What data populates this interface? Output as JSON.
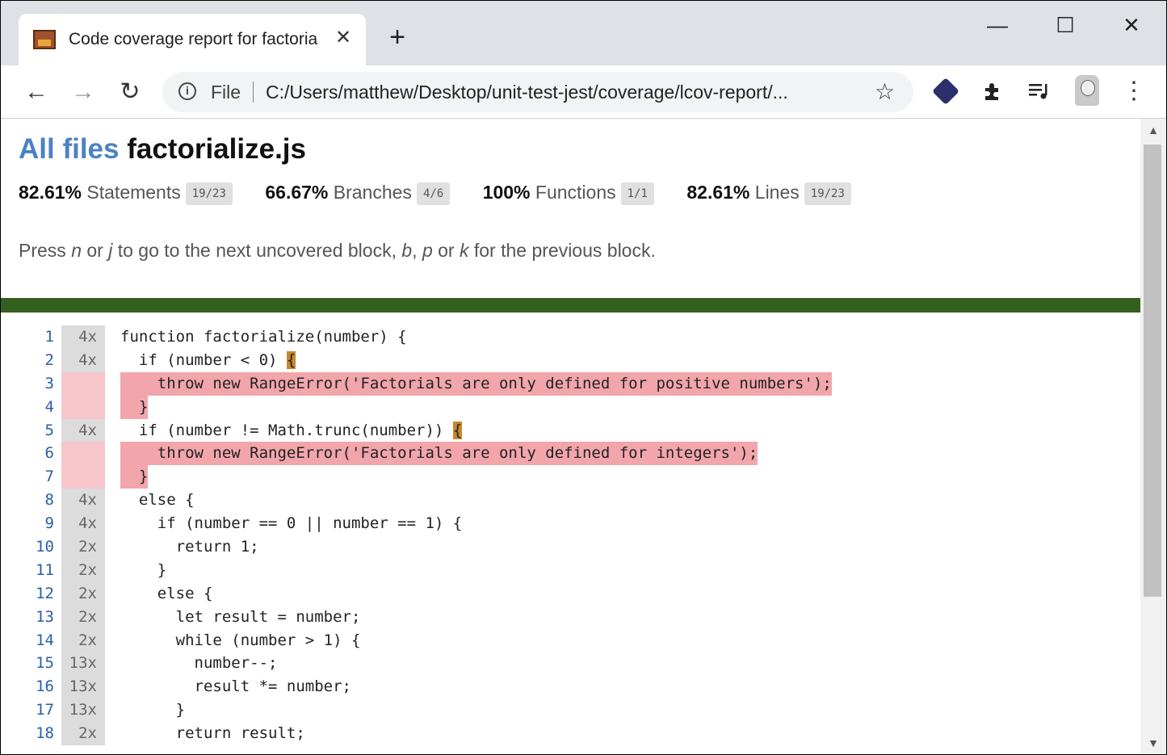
{
  "browser": {
    "tab_title": "Code coverage report for factoria",
    "tab_close": "✕",
    "new_tab": "+",
    "minimize": "—",
    "maximize": "☐",
    "close": "✕",
    "back": "←",
    "forward": "→",
    "reload": "↻",
    "file_label": "File",
    "url": "C:/Users/matthew/Desktop/unit-test-jest/coverage/lcov-report/...",
    "star": "☆",
    "extensions": [
      "hexagon-icon",
      "puzzle-icon",
      "playlist-icon"
    ],
    "menu": "⋮"
  },
  "header": {
    "all_files": "All files",
    "file_name": "factorialize.js"
  },
  "stats": [
    {
      "pct": "82.61%",
      "label": "Statements",
      "frac": "19/23"
    },
    {
      "pct": "66.67%",
      "label": "Branches",
      "frac": "4/6"
    },
    {
      "pct": "100%",
      "label": "Functions",
      "frac": "1/1"
    },
    {
      "pct": "82.61%",
      "label": "Lines",
      "frac": "19/23"
    }
  ],
  "hint": {
    "p1": "Press ",
    "k1": "n",
    "p2": " or ",
    "k2": "j",
    "p3": " to go to the next uncovered block, ",
    "k3": "b",
    "p4": ", ",
    "k4": "p",
    "p5": " or ",
    "k5": "k",
    "p6": " for the previous block."
  },
  "colors": {
    "coverage_bar": "#34601f",
    "missed_line": "#f2a6ac",
    "branch_marker": "#c8872d",
    "link": "#4b82c4"
  },
  "code": [
    {
      "ln": "1",
      "cnt": "4x",
      "text": "function factorialize(number) {"
    },
    {
      "ln": "2",
      "cnt": "4x",
      "text": "  if (number < 0) ",
      "branch": "{"
    },
    {
      "ln": "3",
      "cnt": "",
      "miss": true,
      "text": "    throw new RangeError('Factorials are only defined for positive numbers');"
    },
    {
      "ln": "4",
      "cnt": "",
      "miss": true,
      "text": "  }"
    },
    {
      "ln": "5",
      "cnt": "4x",
      "text": "  if (number != Math.trunc(number)) ",
      "branch": "{"
    },
    {
      "ln": "6",
      "cnt": "",
      "miss": true,
      "text": "    throw new RangeError('Factorials are only defined for integers');"
    },
    {
      "ln": "7",
      "cnt": "",
      "miss": true,
      "text": "  }"
    },
    {
      "ln": "8",
      "cnt": "4x",
      "text": "  else {"
    },
    {
      "ln": "9",
      "cnt": "4x",
      "text": "    if (number == 0 || number == 1) {"
    },
    {
      "ln": "10",
      "cnt": "2x",
      "text": "      return 1;"
    },
    {
      "ln": "11",
      "cnt": "2x",
      "text": "    }"
    },
    {
      "ln": "12",
      "cnt": "2x",
      "text": "    else {"
    },
    {
      "ln": "13",
      "cnt": "2x",
      "text": "      let result = number;"
    },
    {
      "ln": "14",
      "cnt": "2x",
      "text": "      while (number > 1) {"
    },
    {
      "ln": "15",
      "cnt": "13x",
      "text": "        number--;"
    },
    {
      "ln": "16",
      "cnt": "13x",
      "text": "        result *= number;"
    },
    {
      "ln": "17",
      "cnt": "13x",
      "text": "      }"
    },
    {
      "ln": "18",
      "cnt": "2x",
      "text": "      return result;"
    }
  ]
}
